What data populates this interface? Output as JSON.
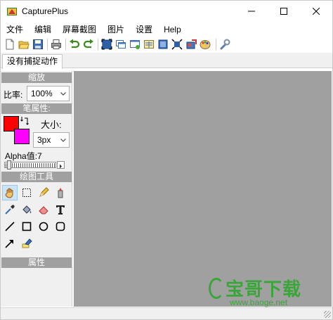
{
  "window": {
    "title": "CapturePlus",
    "controls": {
      "minimize": "minimize-icon",
      "maximize": "maximize-icon",
      "close": "close-icon"
    }
  },
  "menu": [
    "文件",
    "编辑",
    "屏幕截图",
    "图片",
    "设置",
    "Help"
  ],
  "toolbar": [
    "new-file-icon",
    "open-folder-icon",
    "save-icon",
    "print-icon",
    "undo-icon",
    "redo-icon",
    "capture-fullscreen-icon",
    "capture-window-icon",
    "capture-region-icon",
    "capture-menu-icon",
    "capture-object-icon",
    "capture-fixed-region-icon",
    "capture-freehand-icon",
    "color-picker-icon",
    "settings-wrench-icon"
  ],
  "tabs": [
    {
      "label": "没有捕捉动作"
    }
  ],
  "zoom": {
    "header": "缩放",
    "ratio_label": "比率:",
    "ratio_value": "100%"
  },
  "pen": {
    "header": "笔属性:",
    "size_label": "大小:",
    "size_value": "3px",
    "alpha_label": "Alpha值:7",
    "foreground_color": "#ff0000",
    "background_color": "#ff00ff"
  },
  "tools": {
    "header": "绘图工具",
    "items": [
      "hand-icon",
      "selection-rect-icon",
      "pencil-icon",
      "marker-icon",
      "eyedropper-icon",
      "fill-bucket-icon",
      "eraser-icon",
      "text-icon",
      "line-icon",
      "rectangle-icon",
      "ellipse-icon",
      "rounded-rect-icon",
      "arrow-icon",
      "highlighter-icon"
    ]
  },
  "properties": {
    "header": "属性"
  },
  "watermark": {
    "brand": "宝哥下载",
    "url": "www.baoge.net"
  }
}
